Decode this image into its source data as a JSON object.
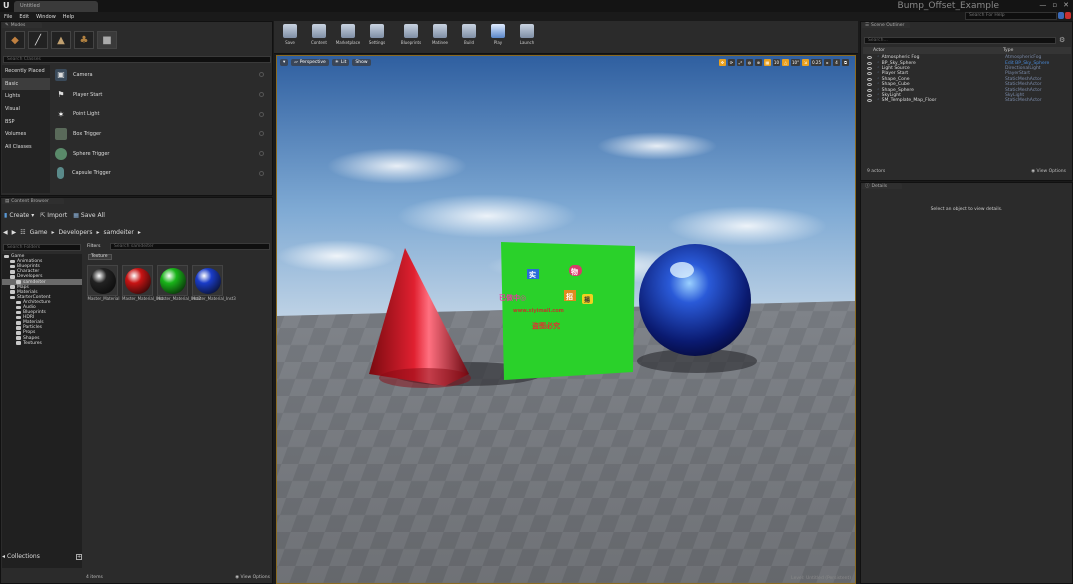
{
  "window": {
    "tab_label": "Untitled",
    "project_title": "Bump_Offset_Example",
    "controls": [
      "—",
      "▫",
      "✕"
    ]
  },
  "menu": [
    "File",
    "Edit",
    "Window",
    "Help"
  ],
  "help_search_placeholder": "Search For Help",
  "modes": {
    "tab_label": "Modes",
    "search_placeholder": "Search Classes",
    "categories": [
      "Recently Placed",
      "Basic",
      "Lights",
      "Visual",
      "BSP",
      "Volumes",
      "All Classes"
    ],
    "selected_category": "Basic",
    "items": [
      {
        "label": "Camera",
        "icon": "camera-icon"
      },
      {
        "label": "Player Start",
        "icon": "player-start-icon"
      },
      {
        "label": "Point Light",
        "icon": "point-light-icon"
      },
      {
        "label": "Box Trigger",
        "icon": "box-trigger-icon"
      },
      {
        "label": "Sphere Trigger",
        "icon": "sphere-trigger-icon"
      },
      {
        "label": "Capsule Trigger",
        "icon": "capsule-trigger-icon"
      }
    ]
  },
  "content_browser": {
    "tab_label": "Content Browser",
    "create_label": "Create",
    "import_label": "Import",
    "save_all_label": "Save All",
    "path": [
      "Game",
      "Developers",
      "samdeiter"
    ],
    "search_folders_placeholder": "Search Folders",
    "filters_label": "Filters",
    "search_assets_placeholder": "Search samdeiter",
    "filter_tag": "Texture",
    "tree": [
      {
        "label": "Game",
        "indent": 0
      },
      {
        "label": "Animations",
        "indent": 1
      },
      {
        "label": "Blueprints",
        "indent": 1
      },
      {
        "label": "Character",
        "indent": 1
      },
      {
        "label": "Developers",
        "indent": 1
      },
      {
        "label": "samdeiter",
        "indent": 2
      },
      {
        "label": "Maps",
        "indent": 1
      },
      {
        "label": "Materials",
        "indent": 1
      },
      {
        "label": "StarterContent",
        "indent": 1
      },
      {
        "label": "Architecture",
        "indent": 2
      },
      {
        "label": "Audio",
        "indent": 2
      },
      {
        "label": "Blueprints",
        "indent": 2
      },
      {
        "label": "HDRI",
        "indent": 2
      },
      {
        "label": "Materials",
        "indent": 2
      },
      {
        "label": "Particles",
        "indent": 2
      },
      {
        "label": "Props",
        "indent": 2
      },
      {
        "label": "Shapes",
        "indent": 2
      },
      {
        "label": "Textures",
        "indent": 2
      }
    ],
    "assets": [
      {
        "label": "Master_Material",
        "color": "#222222"
      },
      {
        "label": "Master_Material_Inst",
        "color": "#c81414"
      },
      {
        "label": "Master_Material_Inst2",
        "color": "#19b419"
      },
      {
        "label": "Master_Material_Inst3",
        "color": "#1a3cc8"
      }
    ],
    "collections_label": "Collections",
    "item_count": "4 items",
    "view_options_label": "View Options"
  },
  "toolbar": [
    "Save",
    "Content",
    "Marketplace",
    "Settings",
    "Blueprints",
    "Matinee",
    "Build",
    "Play",
    "Launch"
  ],
  "viewport": {
    "perspective_label": "Perspective",
    "lit_label": "Lit",
    "show_label": "Show",
    "snap_grid": "10",
    "snap_rot": "10°",
    "snap_scale": "0.25",
    "camera_speed": "4",
    "level_label": "Level: Untitled (Persistent)",
    "watermark_lines": [
      "实",
      "物",
      "已做中◎",
      "www.xiyimall.com",
      "盗图必究",
      "招",
      "揚"
    ]
  },
  "outliner": {
    "tab_label": "Scene Outliner",
    "search_placeholder": "Search...",
    "col_actor": "Actor",
    "col_type": "Type",
    "rows": [
      {
        "name": "Atmospheric Fog",
        "type": "AtmosphericFog"
      },
      {
        "name": "BP_Sky_Sphere",
        "type": "Edit BP_Sky_Sphere",
        "link": true
      },
      {
        "name": "Light Source",
        "type": "DirectionalLight"
      },
      {
        "name": "Player Start",
        "type": "PlayerStart"
      },
      {
        "name": "Shape_Cone",
        "type": "StaticMeshActor"
      },
      {
        "name": "Shape_Cube",
        "type": "StaticMeshActor"
      },
      {
        "name": "Shape_Sphere",
        "type": "StaticMeshActor"
      },
      {
        "name": "SkyLight",
        "type": "SkyLight"
      },
      {
        "name": "SM_Template_Map_Floor",
        "type": "StaticMeshActor"
      }
    ],
    "actor_count": "9 actors",
    "view_options_label": "View Options"
  },
  "details": {
    "tab_label": "Details",
    "empty_message": "Select an object to view details."
  },
  "colors": {
    "accent": "#e8a020",
    "link": "#4a8ad8",
    "panel": "#2b2b2b"
  }
}
